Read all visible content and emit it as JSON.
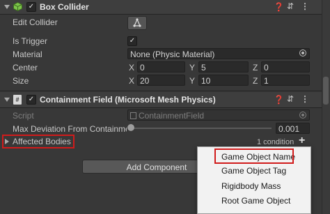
{
  "box_collider": {
    "title": "Box Collider",
    "edit_collider_label": "Edit Collider",
    "is_trigger_label": "Is Trigger",
    "material_label": "Material",
    "material_value": "None (Physic Material)",
    "center_label": "Center",
    "center": {
      "x_label": "X",
      "x": "0",
      "y_label": "Y",
      "y": "5",
      "z_label": "Z",
      "z": "0"
    },
    "size_label": "Size",
    "size": {
      "x_label": "X",
      "x": "20",
      "y_label": "Y",
      "y": "10",
      "z_label": "Z",
      "z": "1"
    }
  },
  "containment_field": {
    "title": "Containment Field (Microsoft Mesh Physics)",
    "script_label": "Script",
    "script_value": "ContainmentField",
    "max_deviation_label": "Max Deviation From Containme",
    "max_deviation_value": "0.001",
    "max_deviation_slider_fraction": 0.0,
    "affected_bodies_label": "Affected Bodies",
    "condition_count": "1 condition"
  },
  "add_component_label": "Add Component",
  "popup_menu": {
    "items": [
      "Game Object Name",
      "Game Object Tag",
      "Rigidbody Mass",
      "Root Game Object"
    ]
  },
  "icons": {
    "header_help": "help-icon",
    "header_presets": "presets-icon",
    "header_more": "more-icon",
    "checkmark": "checkmark-icon",
    "target": "object-picker-icon",
    "plus": "add-icon"
  },
  "colors": {
    "highlight_red": "#d11b1b",
    "panel_bg": "#383838",
    "popup_bg": "#f2f2f2"
  }
}
